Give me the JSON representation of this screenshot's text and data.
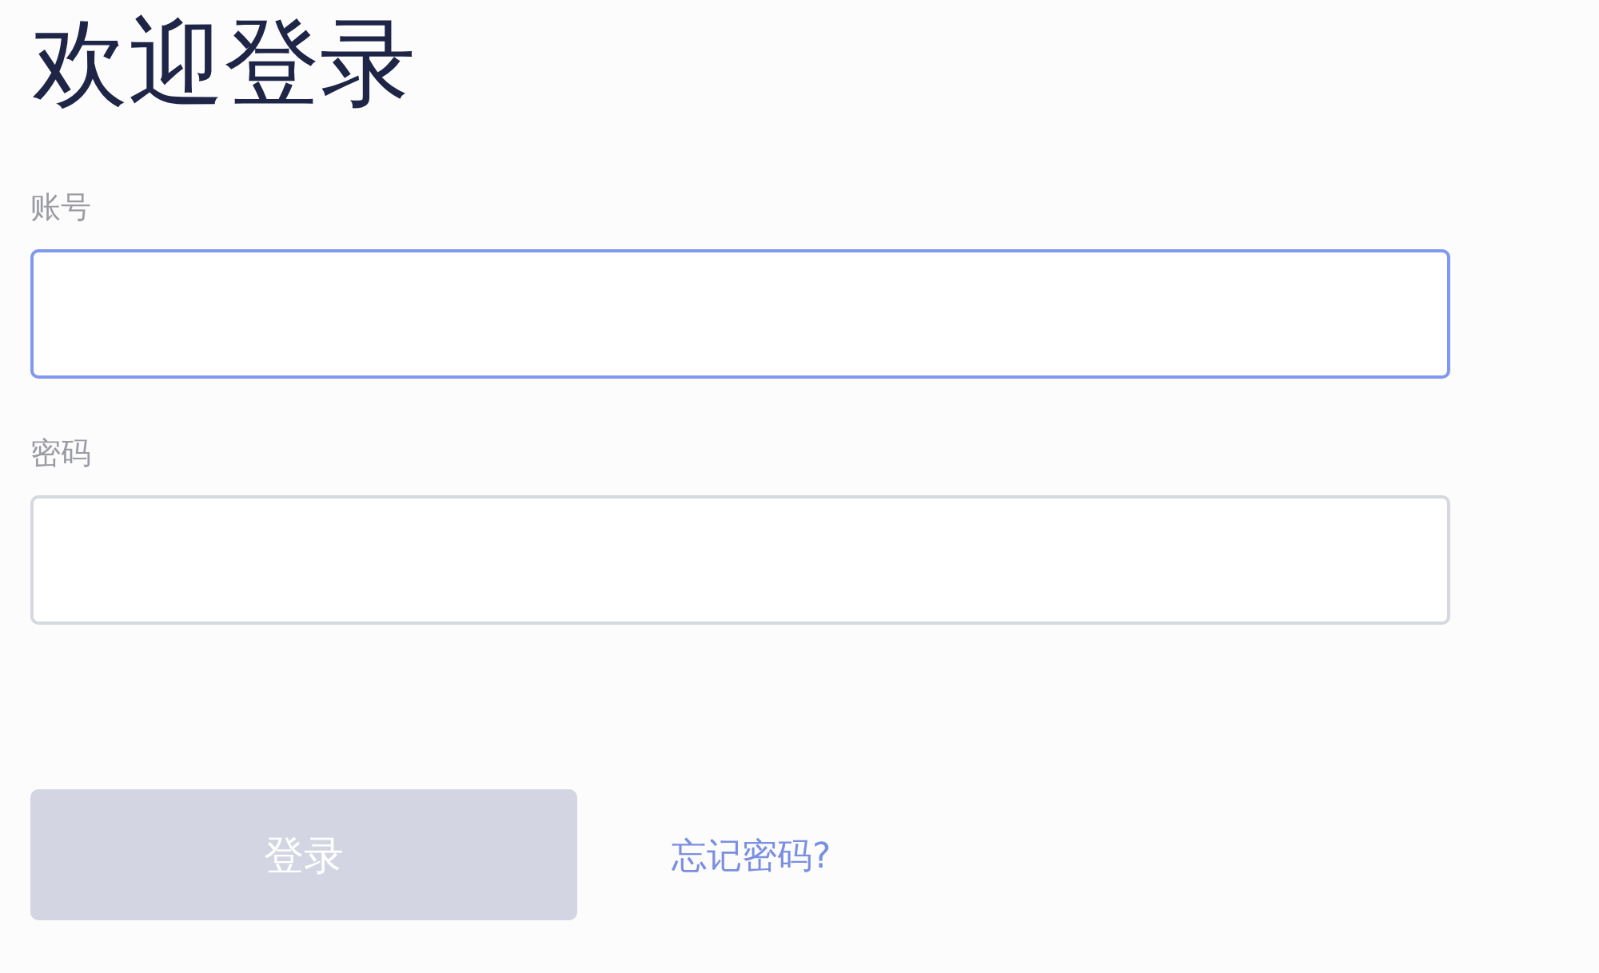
{
  "title": "欢迎登录",
  "fields": [
    {
      "label": "账号",
      "focused": true
    },
    {
      "label": "密码",
      "focused": false
    }
  ],
  "login_button": {
    "label": "登录",
    "disabled": true
  },
  "forgot_password_link": "忘记密码?"
}
